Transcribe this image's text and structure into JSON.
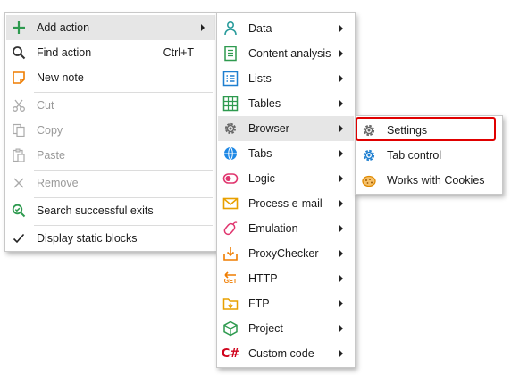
{
  "main_menu": {
    "items": [
      {
        "label": "Add action",
        "icon": "plus-icon",
        "has_submenu": true
      },
      {
        "label": "Find action",
        "shortcut": "Ctrl+T",
        "icon": "search-icon"
      },
      {
        "label": "New note",
        "icon": "note-icon"
      },
      {
        "label": "Cut",
        "icon": "scissors-icon",
        "disabled": true
      },
      {
        "label": "Copy",
        "icon": "copy-icon",
        "disabled": true
      },
      {
        "label": "Paste",
        "icon": "paste-icon",
        "disabled": true
      },
      {
        "label": "Remove",
        "icon": "close-icon",
        "disabled": true
      },
      {
        "label": "Search successful exits",
        "icon": "search-exits-icon"
      },
      {
        "label": "Display static blocks",
        "icon": "checkmark-icon"
      }
    ]
  },
  "action_submenu": {
    "items": [
      {
        "label": "Data",
        "icon": "data-icon"
      },
      {
        "label": "Content analysis",
        "icon": "content-analysis-icon"
      },
      {
        "label": "Lists",
        "icon": "list-icon"
      },
      {
        "label": "Tables",
        "icon": "table-icon"
      },
      {
        "label": "Browser",
        "icon": "gear-icon"
      },
      {
        "label": "Tabs",
        "icon": "globe-icon"
      },
      {
        "label": "Logic",
        "icon": "logic-icon"
      },
      {
        "label": "Process e-mail",
        "icon": "mail-icon"
      },
      {
        "label": "Emulation",
        "icon": "mouse-icon"
      },
      {
        "label": "ProxyChecker",
        "icon": "proxy-icon"
      },
      {
        "label": "HTTP",
        "icon": "http-get-icon",
        "icon_text": "GET"
      },
      {
        "label": "FTP",
        "icon": "folder-icon"
      },
      {
        "label": "Project",
        "icon": "cube-icon"
      },
      {
        "label": "Custom code",
        "icon": "csharp-icon",
        "icon_text": "C#"
      }
    ]
  },
  "browser_submenu": {
    "items": [
      {
        "label": "Settings",
        "icon": "gear-icon"
      },
      {
        "label": "Tab control",
        "icon": "tab-control-icon"
      },
      {
        "label": "Works with Cookies",
        "icon": "cookie-icon"
      }
    ]
  },
  "colors": {
    "accent_green": "#2e9a4f",
    "accent_blue": "#1e7fd0",
    "highlight_bg": "#e6e6e6",
    "selection_frame": "#e00000"
  }
}
